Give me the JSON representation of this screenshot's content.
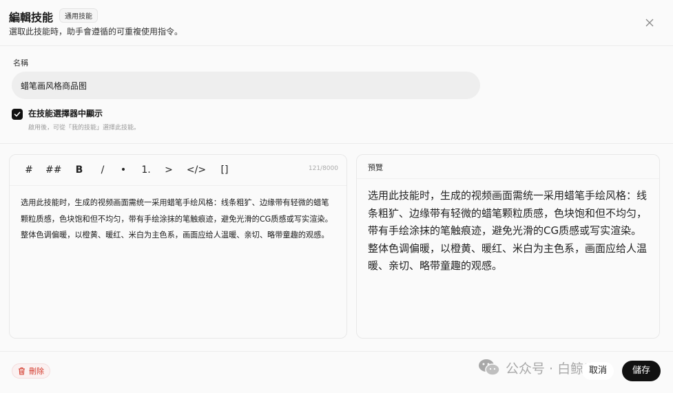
{
  "header": {
    "title": "編輯技能",
    "badge": "通用技能",
    "subtitle": "選取此技能時，助手會遵循的可重複使用指令。",
    "close_icon": "close-icon"
  },
  "name_field": {
    "label": "名稱",
    "value": "蜡笔画风格商品图"
  },
  "show_in_picker": {
    "checked": true,
    "label": "在技能選擇器中顯示",
    "hint": "啟用後，可從「我的技能」選擇此技能。"
  },
  "editor": {
    "toolbar": [
      "#",
      "##",
      "B",
      "/",
      "•",
      "1.",
      ">",
      "</>",
      "[]"
    ],
    "counter": "121/8000",
    "content": "选用此技能时，生成的视频画面需统一采用蜡笔手绘风格：线条粗犷、边缘带有轻微的蜡笔颗粒质感，色块饱和但不均匀，带有手绘涂抹的笔触痕迹，避免光滑的CG质感或写实渲染。整体色调偏暖，以橙黄、暖红、米白为主色系，画面应给人温暖、亲切、略带童趣的观感。"
  },
  "preview": {
    "title": "預覽",
    "content": "选用此技能时，生成的视频画面需统一采用蜡笔手绘风格：线条粗犷、边缘带有轻微的蜡笔颗粒质感，色块饱和但不均匀，带有手绘涂抹的笔触痕迹，避免光滑的CG质感或写实渲染。整体色调偏暖，以橙黄、暖红、米白为主色系，画面应给人温暖、亲切、略带童趣的观感。"
  },
  "footer": {
    "delete_label": "刪除",
    "delete_icon": "trash-icon",
    "cancel_label": "取消",
    "save_label": "儲存",
    "watermark": "公众号 · 白鲸出海",
    "watermark_icon": "wechat-icon"
  },
  "colors": {
    "primary": "#111111",
    "danger": "#d33a2c",
    "background": "#fafafa"
  }
}
